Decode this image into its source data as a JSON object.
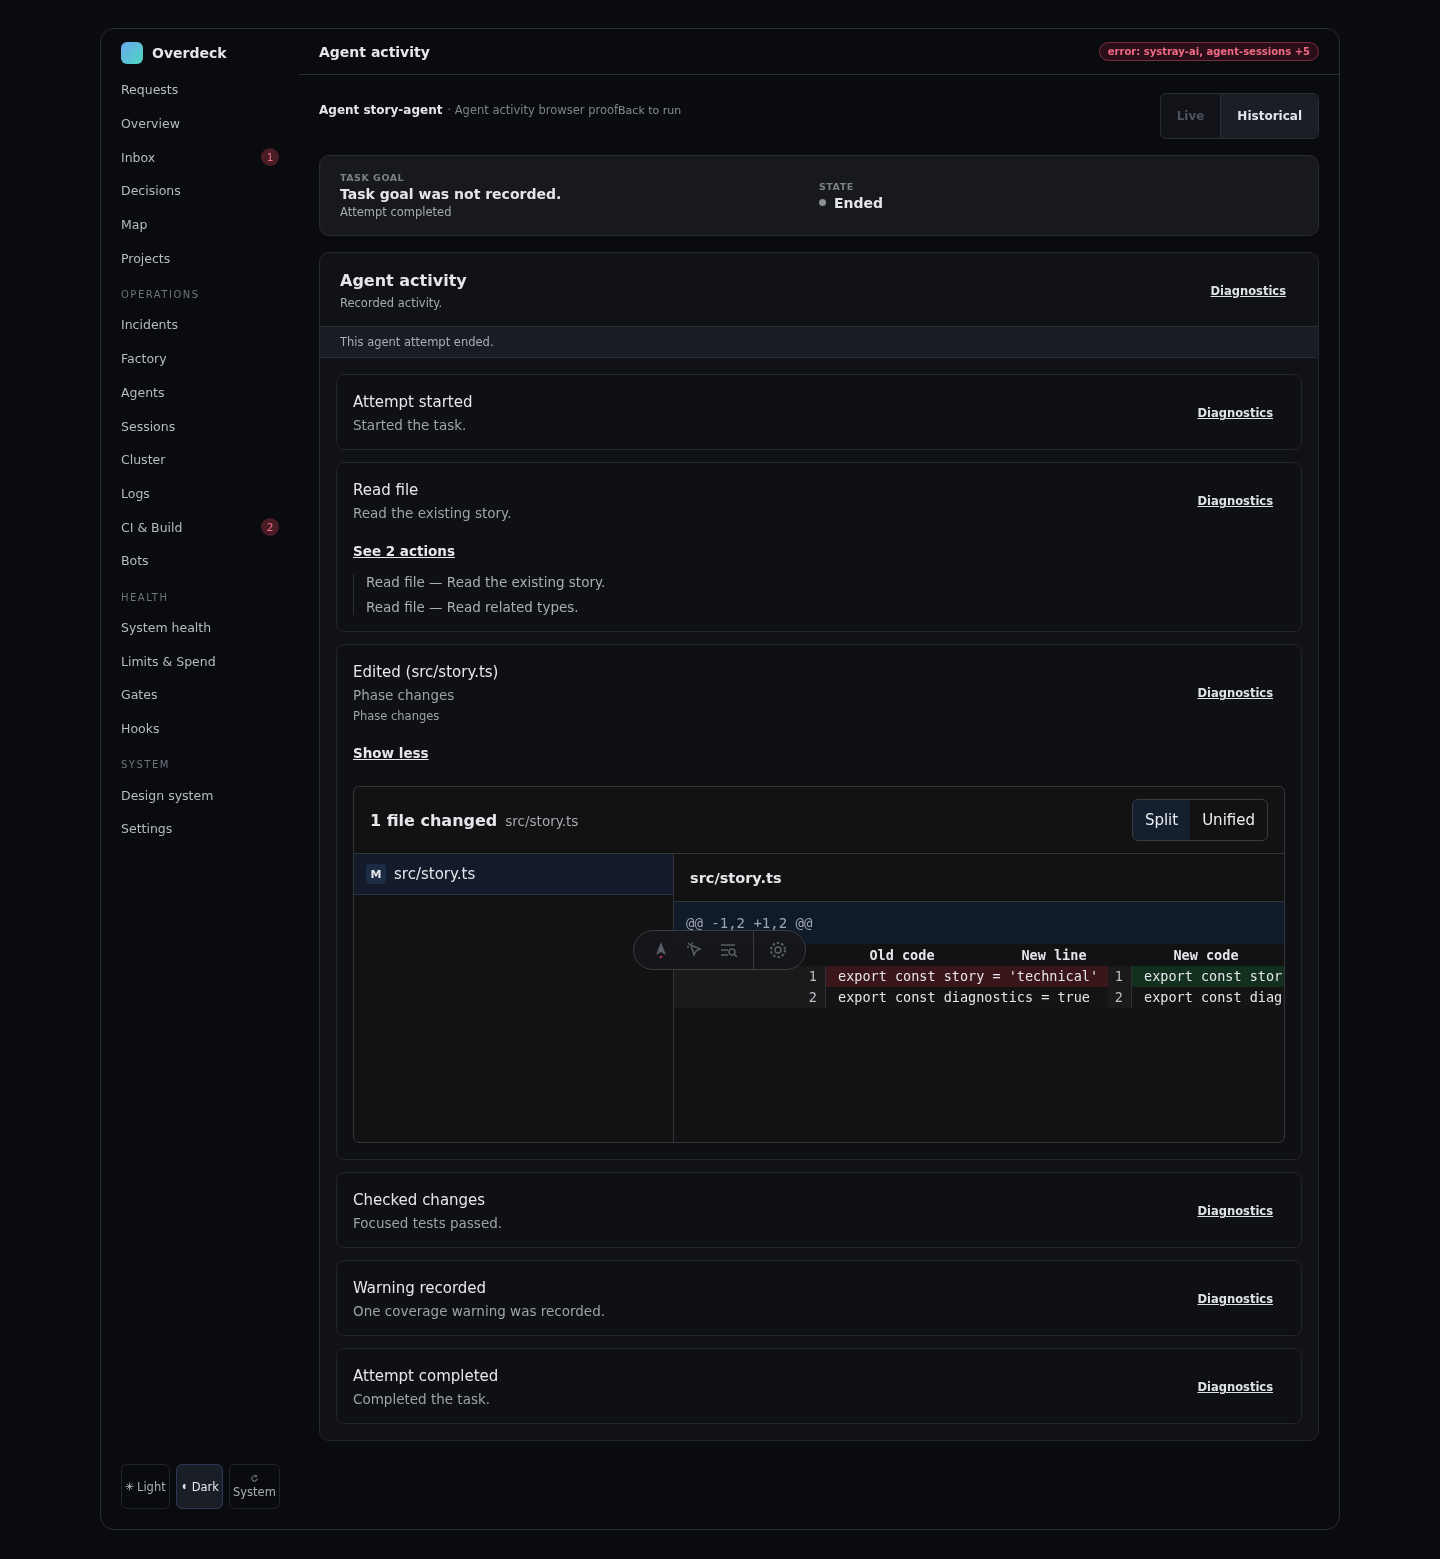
{
  "brand": {
    "name": "Overdeck"
  },
  "nav": [
    {
      "kind": "item",
      "label": "Requests"
    },
    {
      "kind": "item",
      "label": "Overview"
    },
    {
      "kind": "item",
      "label": "Inbox",
      "badge": "1"
    },
    {
      "kind": "item",
      "label": "Decisions"
    },
    {
      "kind": "item",
      "label": "Map"
    },
    {
      "kind": "item",
      "label": "Projects"
    },
    {
      "kind": "section",
      "label": "OPERATIONS"
    },
    {
      "kind": "item",
      "label": "Incidents"
    },
    {
      "kind": "item",
      "label": "Factory"
    },
    {
      "kind": "item",
      "label": "Agents"
    },
    {
      "kind": "item",
      "label": "Sessions"
    },
    {
      "kind": "item",
      "label": "Cluster"
    },
    {
      "kind": "item",
      "label": "Logs"
    },
    {
      "kind": "item",
      "label": "CI & Build",
      "badge": "2"
    },
    {
      "kind": "item",
      "label": "Bots"
    },
    {
      "kind": "section",
      "label": "HEALTH"
    },
    {
      "kind": "item",
      "label": "System health"
    },
    {
      "kind": "item",
      "label": "Limits & Spend"
    },
    {
      "kind": "item",
      "label": "Gates"
    },
    {
      "kind": "item",
      "label": "Hooks"
    },
    {
      "kind": "section",
      "label": "SYSTEM"
    },
    {
      "kind": "item",
      "label": "Design system"
    },
    {
      "kind": "item",
      "label": "Settings"
    }
  ],
  "themes": [
    {
      "kind": "light",
      "label": "Light",
      "selected": false
    },
    {
      "kind": "dark",
      "label": "Dark",
      "selected": true
    },
    {
      "kind": "system",
      "label": "System",
      "selected": false
    }
  ],
  "header": {
    "title": "Agent activity",
    "error": "error: systray-ai, agent-sessions +5"
  },
  "subheader": {
    "agent": "Agent story-agent",
    "context": "· Agent activity browser proof",
    "back": "Back to run"
  },
  "modes": [
    {
      "label": "Live",
      "selected": false
    },
    {
      "label": "Historical",
      "selected": true
    }
  ],
  "goal": {
    "label": "TASK GOAL",
    "text": "Task goal was not recorded.",
    "detail": "Attempt completed",
    "state_label": "STATE",
    "state": "Ended"
  },
  "activity": {
    "title": "Agent activity",
    "subtitle": "Recorded activity.",
    "link": "Diagnostics",
    "banner": "This agent attempt ended."
  },
  "events": [
    {
      "kind": "simple",
      "title": "Attempt started",
      "detail": "Started the task.",
      "link": "Diagnostics"
    },
    {
      "kind": "actions",
      "title": "Read file",
      "detail": "Read the existing story.",
      "link": "Diagnostics",
      "toggle": "See 2 actions",
      "actions": [
        "Read file — Read the existing story.",
        "Read file — Read related types."
      ]
    },
    {
      "kind": "diff",
      "title": "Edited (src/story.ts)",
      "detail": "Phase changes",
      "note": "Phase changes",
      "link": "Diagnostics",
      "toggle": "Show less",
      "diff": {
        "summary": "1 file changed",
        "path": "src/story.ts",
        "views": [
          {
            "label": "Split",
            "selected": true
          },
          {
            "label": "Unified",
            "selected": false
          }
        ],
        "files": [
          {
            "status": "M",
            "path": "src/story.ts",
            "selected": true
          }
        ],
        "file_title": "src/story.ts",
        "hunk": "@@ -1,2 +1,2 @@",
        "columns": [
          "Old code",
          "New line",
          "New code"
        ],
        "rows": [
          {
            "old_line": "1",
            "old_code": "export const story = 'technical'",
            "new_line": "1",
            "new_code": "export const stor",
            "changed": true
          },
          {
            "old_line": "2",
            "old_code": "export const diagnostics = true",
            "new_line": "2",
            "new_code": "export const diag",
            "changed": false
          }
        ]
      }
    },
    {
      "kind": "simple",
      "title": "Checked changes",
      "detail": "Focused tests passed.",
      "link": "Diagnostics"
    },
    {
      "kind": "simple",
      "title": "Warning recorded",
      "detail": "One coverage warning was recorded.",
      "link": "Diagnostics"
    },
    {
      "kind": "simple",
      "title": "Attempt completed",
      "detail": "Completed the task.",
      "link": "Diagnostics"
    }
  ]
}
